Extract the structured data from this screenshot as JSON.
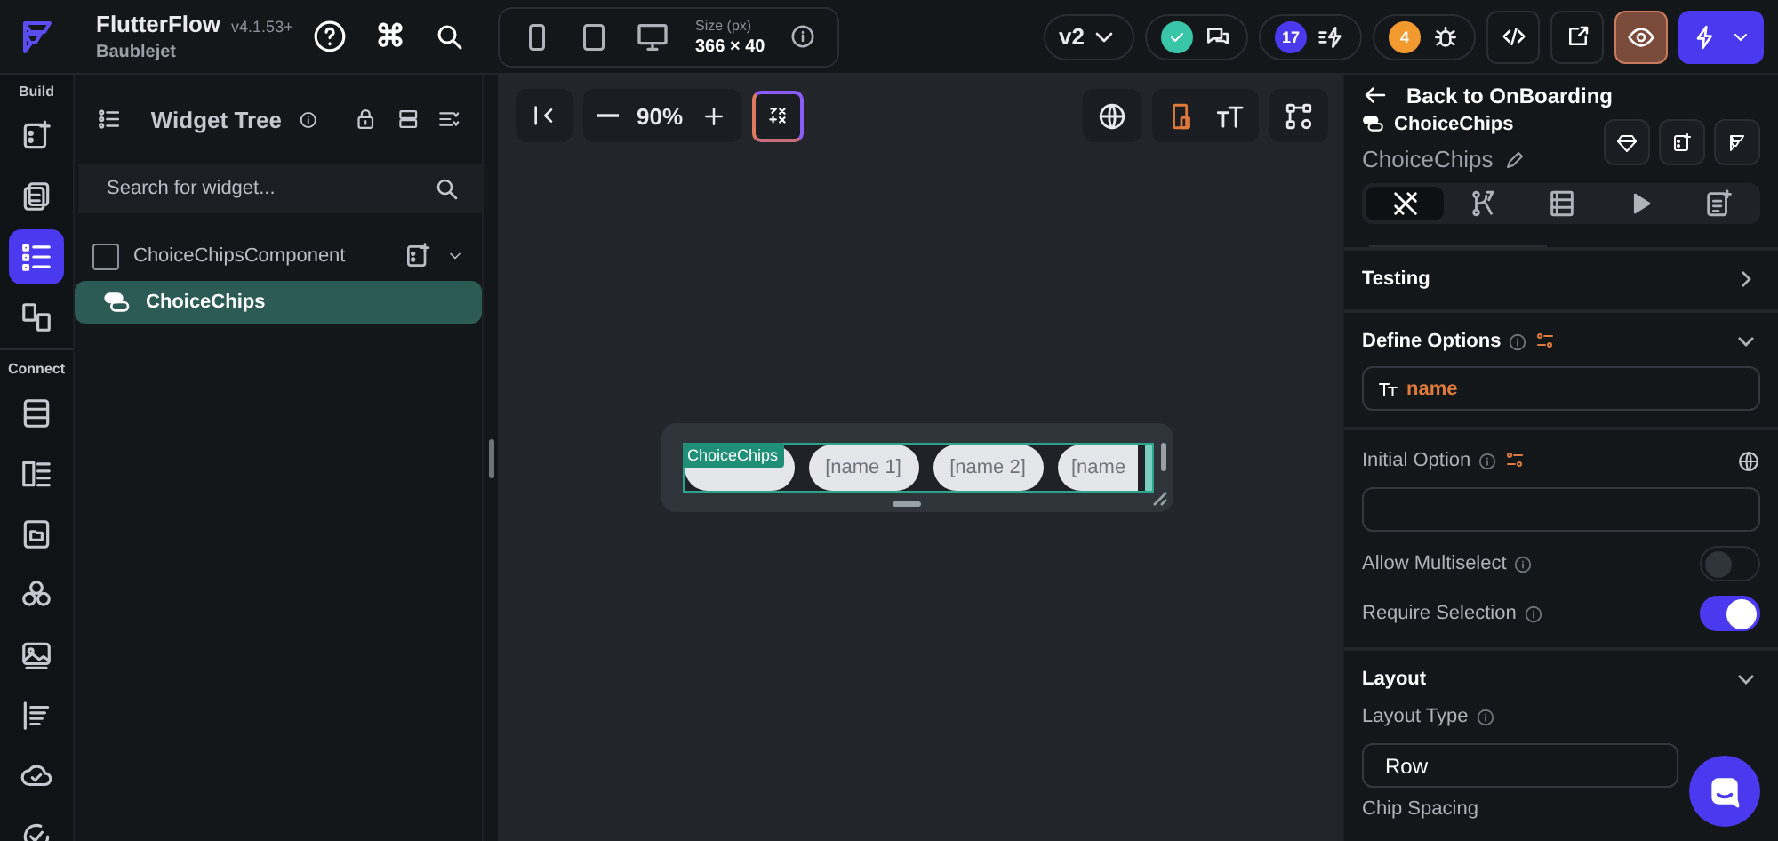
{
  "app": {
    "name": "FlutterFlow",
    "version": "v4.1.53+",
    "project": "Baublejet",
    "command_key": "⌘"
  },
  "device_bar": {
    "size_label": "Size (px)",
    "size_value": "366 × 40"
  },
  "topbar": {
    "branch": "v2",
    "comments_resolved": true,
    "actions_count": "17",
    "issues_count": "4",
    "preview_on": true
  },
  "rail": [
    {
      "title": "Build",
      "items": [
        {
          "selected": false
        },
        {
          "selected": false
        },
        {
          "selected": true
        },
        {
          "selected": false
        }
      ]
    },
    {
      "title": "Connect",
      "items": [
        {
          "selected": false
        },
        {
          "selected": false
        },
        {
          "selected": false
        },
        {
          "selected": false
        },
        {
          "selected": false
        },
        {
          "selected": false
        },
        {
          "selected": false
        },
        {
          "selected": false
        }
      ]
    }
  ],
  "widget_tree": {
    "title": "Widget Tree",
    "search": {
      "placeholder": "Search for widget..."
    },
    "nodes": [
      {
        "label": "ChoiceChipsComponent",
        "selected": false,
        "children": [
          {
            "label": "ChoiceChips",
            "selected": true
          }
        ]
      }
    ]
  },
  "canvas": {
    "zoom": "90%",
    "widget_tag": "ChoiceChips",
    "chips": [
      {
        "label": "[name 1]"
      },
      {
        "label": "[name 2]"
      },
      {
        "label": "[name"
      }
    ]
  },
  "properties": {
    "back_link": "Back to OnBoarding",
    "widget_type": "ChoiceChips",
    "widget_name": "ChoiceChips",
    "tabs": [
      {
        "selected": true
      },
      {
        "selected": false
      },
      {
        "selected": false
      },
      {
        "selected": false
      },
      {
        "selected": false
      }
    ],
    "sections": [
      {
        "kind": "collapsed",
        "title": "Testing",
        "expanded": false
      },
      {
        "kind": "options",
        "title": "Define Options",
        "expanded": true,
        "option_value": "name",
        "initial_option": {
          "label": "Initial Option"
        },
        "toggles": [
          {
            "label": "Allow Multiselect",
            "on": false
          },
          {
            "label": "Require Selection",
            "on": true
          }
        ]
      },
      {
        "kind": "layout",
        "title": "Layout",
        "expanded": true,
        "layout_type": {
          "label": "Layout Type",
          "value": "Row"
        },
        "next_label": "Chip Spacing"
      }
    ]
  }
}
